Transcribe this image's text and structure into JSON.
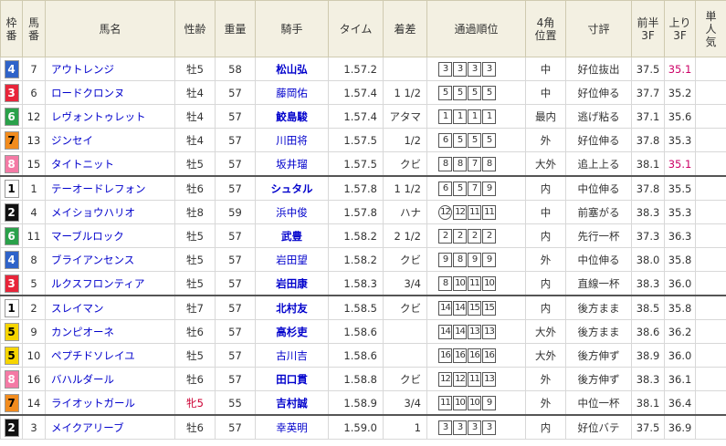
{
  "headers": {
    "waku": [
      "枠",
      "番"
    ],
    "umaban": [
      "馬",
      "番"
    ],
    "name": "馬名",
    "sex": "性齢",
    "weight": "重量",
    "jockey": "騎手",
    "time": "タイム",
    "margin": "着差",
    "passing": "通過順位",
    "corner": [
      "4角",
      "位置"
    ],
    "comment": "寸評",
    "first3f": [
      "前半",
      "3F"
    ],
    "last3f": [
      "上り",
      "3F"
    ],
    "pop": [
      "単",
      "人",
      "気"
    ]
  },
  "waku_colors": {
    "1": {
      "bg": "#ffffff",
      "fg": "#000000"
    },
    "2": {
      "bg": "#111111",
      "fg": "#ffffff"
    },
    "3": {
      "bg": "#e8253a",
      "fg": "#ffffff"
    },
    "4": {
      "bg": "#2f63c9",
      "fg": "#ffffff"
    },
    "5": {
      "bg": "#f6d500",
      "fg": "#000000"
    },
    "6": {
      "bg": "#2aa14a",
      "fg": "#ffffff"
    },
    "7": {
      "bg": "#f28c1e",
      "fg": "#000000"
    },
    "8": {
      "bg": "#f47aa5",
      "fg": "#ffffff"
    }
  },
  "rows": [
    {
      "waku": "4",
      "num": "7",
      "name": "アウトレンジ",
      "sex": "牡5",
      "wt": "58",
      "jockey": "松山弘",
      "jb": true,
      "time": "1.57.2",
      "margin": "",
      "pass": [
        "3",
        "3",
        "3",
        "3"
      ],
      "corner": "中",
      "comment": "好位抜出",
      "f3": "37.5",
      "l3": "35.1",
      "l3pink": true,
      "pop": "",
      "sep": false,
      "mare": false
    },
    {
      "waku": "3",
      "num": "6",
      "name": "ロードクロンヌ",
      "sex": "牡4",
      "wt": "57",
      "jockey": "藤岡佑",
      "jb": false,
      "time": "1.57.4",
      "margin": "1 1/2",
      "pass": [
        "5",
        "5",
        "5",
        "5"
      ],
      "corner": "中",
      "comment": "好位伸る",
      "f3": "37.7",
      "l3": "35.2",
      "l3pink": false,
      "pop": "",
      "sep": false,
      "mare": false
    },
    {
      "waku": "6",
      "num": "12",
      "name": "レヴォントゥレット",
      "sex": "牡4",
      "wt": "57",
      "jockey": "鮫島駿",
      "jb": true,
      "time": "1.57.4",
      "margin": "アタマ",
      "pass": [
        "1",
        "1",
        "1",
        "1"
      ],
      "corner": "最内",
      "comment": "逃げ粘る",
      "f3": "37.1",
      "l3": "35.6",
      "l3pink": false,
      "pop": "",
      "sep": false,
      "mare": false
    },
    {
      "waku": "7",
      "num": "13",
      "name": "ジンセイ",
      "sex": "牡4",
      "wt": "57",
      "jockey": "川田将",
      "jb": false,
      "time": "1.57.5",
      "margin": "1/2",
      "pass": [
        "6",
        "5",
        "5",
        "5"
      ],
      "corner": "外",
      "comment": "好位伸る",
      "f3": "37.8",
      "l3": "35.3",
      "l3pink": false,
      "pop": "",
      "sep": false,
      "mare": false
    },
    {
      "waku": "8",
      "num": "15",
      "name": "タイトニット",
      "sex": "牡5",
      "wt": "57",
      "jockey": "坂井瑠",
      "jb": false,
      "time": "1.57.5",
      "margin": "クビ",
      "pass": [
        "8",
        "8",
        "7",
        "8"
      ],
      "corner": "大外",
      "comment": "追上上る",
      "f3": "38.1",
      "l3": "35.1",
      "l3pink": true,
      "pop": "",
      "sep": false,
      "mare": false
    },
    {
      "waku": "1",
      "num": "1",
      "name": "テーオードレフォン",
      "sex": "牡6",
      "wt": "57",
      "jockey": "シュタル",
      "jb": true,
      "time": "1.57.8",
      "margin": "1 1/2",
      "pass": [
        "6",
        "5",
        "7",
        "9"
      ],
      "corner": "内",
      "comment": "中位伸る",
      "f3": "37.8",
      "l3": "35.5",
      "l3pink": false,
      "pop": "",
      "sep": true,
      "mare": false
    },
    {
      "waku": "2",
      "num": "4",
      "name": "メイショウハリオ",
      "sex": "牡8",
      "wt": "59",
      "jockey": "浜中俊",
      "jb": false,
      "time": "1.57.8",
      "margin": "ハナ",
      "pass": [
        "12",
        "12",
        "11",
        "11"
      ],
      "passFirstCircle": true,
      "corner": "中",
      "comment": "前塞がる",
      "f3": "38.3",
      "l3": "35.3",
      "l3pink": false,
      "pop": "",
      "sep": false,
      "mare": false
    },
    {
      "waku": "6",
      "num": "11",
      "name": "マーブルロック",
      "sex": "牡5",
      "wt": "57",
      "jockey": "武豊",
      "jb": true,
      "time": "1.58.2",
      "margin": "2 1/2",
      "pass": [
        "2",
        "2",
        "2",
        "2"
      ],
      "corner": "内",
      "comment": "先行一杯",
      "f3": "37.3",
      "l3": "36.3",
      "l3pink": false,
      "pop": "",
      "sep": false,
      "mare": false
    },
    {
      "waku": "4",
      "num": "8",
      "name": "ブライアンセンス",
      "sex": "牡5",
      "wt": "57",
      "jockey": "岩田望",
      "jb": false,
      "time": "1.58.2",
      "margin": "クビ",
      "pass": [
        "9",
        "8",
        "9",
        "9"
      ],
      "corner": "外",
      "comment": "中位伸る",
      "f3": "38.0",
      "l3": "35.8",
      "l3pink": false,
      "pop": "",
      "sep": false,
      "mare": false
    },
    {
      "waku": "3",
      "num": "5",
      "name": "ルクスフロンティア",
      "sex": "牡5",
      "wt": "57",
      "jockey": "岩田康",
      "jb": true,
      "time": "1.58.3",
      "margin": "3/4",
      "pass": [
        "8",
        "10",
        "11",
        "10"
      ],
      "corner": "内",
      "comment": "直線一杯",
      "f3": "38.3",
      "l3": "36.0",
      "l3pink": false,
      "pop": "",
      "sep": false,
      "mare": false
    },
    {
      "waku": "1",
      "num": "2",
      "name": "スレイマン",
      "sex": "牡7",
      "wt": "57",
      "jockey": "北村友",
      "jb": true,
      "time": "1.58.5",
      "margin": "クビ",
      "pass": [
        "14",
        "14",
        "15",
        "15"
      ],
      "corner": "内",
      "comment": "後方まま",
      "f3": "38.5",
      "l3": "35.8",
      "l3pink": false,
      "pop": "",
      "sep": true,
      "mare": false
    },
    {
      "waku": "5",
      "num": "9",
      "name": "カンピオーネ",
      "sex": "牡6",
      "wt": "57",
      "jockey": "高杉吏",
      "jb": true,
      "time": "1.58.6",
      "margin": "",
      "pass": [
        "14",
        "14",
        "13",
        "13"
      ],
      "corner": "大外",
      "comment": "後方まま",
      "f3": "38.6",
      "l3": "36.2",
      "l3pink": false,
      "pop": "",
      "sep": false,
      "mare": false
    },
    {
      "waku": "5",
      "num": "10",
      "name": "ペプチドソレイユ",
      "sex": "牡5",
      "wt": "57",
      "jockey": "古川吉",
      "jb": false,
      "time": "1.58.6",
      "margin": "",
      "pass": [
        "16",
        "16",
        "16",
        "16"
      ],
      "corner": "大外",
      "comment": "後方伸ず",
      "f3": "38.9",
      "l3": "36.0",
      "l3pink": false,
      "pop": "",
      "sep": false,
      "mare": false
    },
    {
      "waku": "8",
      "num": "16",
      "name": "バハルダール",
      "sex": "牡6",
      "wt": "57",
      "jockey": "田口貫",
      "jb": true,
      "time": "1.58.8",
      "margin": "クビ",
      "pass": [
        "12",
        "12",
        "11",
        "13"
      ],
      "corner": "外",
      "comment": "後方伸ず",
      "f3": "38.3",
      "l3": "36.1",
      "l3pink": false,
      "pop": "",
      "sep": false,
      "mare": false
    },
    {
      "waku": "7",
      "num": "14",
      "name": "ライオットガール",
      "sex": "牝5",
      "wt": "55",
      "jockey": "吉村誠",
      "jb": true,
      "time": "1.58.9",
      "margin": "3/4",
      "pass": [
        "11",
        "10",
        "10",
        "9"
      ],
      "corner": "外",
      "comment": "中位一杯",
      "f3": "38.1",
      "l3": "36.4",
      "l3pink": false,
      "pop": "",
      "sep": false,
      "mare": true
    },
    {
      "waku": "2",
      "num": "3",
      "name": "メイクアリーブ",
      "sex": "牡6",
      "wt": "57",
      "jockey": "幸英明",
      "jb": false,
      "time": "1.59.0",
      "margin": "1",
      "pass": [
        "3",
        "3",
        "3",
        "3"
      ],
      "corner": "内",
      "comment": "好位バテ",
      "f3": "37.5",
      "l3": "36.9",
      "l3pink": false,
      "pop": "",
      "sep": true,
      "mare": false
    }
  ]
}
